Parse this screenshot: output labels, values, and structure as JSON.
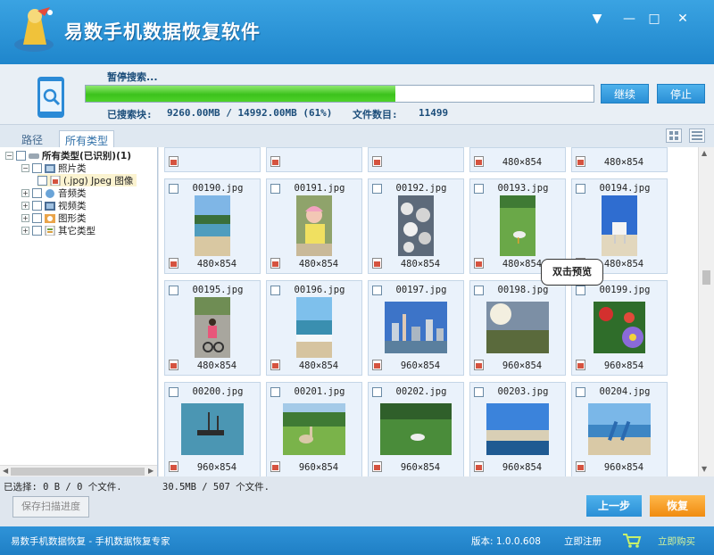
{
  "app": {
    "title": "易数手机数据恢复软件",
    "window_controls": {
      "menu": "▼",
      "minimize": "—",
      "maximize": "□",
      "close": "✕"
    }
  },
  "scan": {
    "status": "暂停搜索...",
    "progress_fraction": 0.61,
    "continue_label": "继续",
    "stop_label": "停止",
    "searched_label": "已搜索块:",
    "searched_value": "9260.00MB / 14992.00MB (61%)",
    "file_count_label": "文件数目:",
    "file_count_value": "11499"
  },
  "tabs": [
    {
      "label": "路径",
      "active": false
    },
    {
      "label": "所有类型",
      "active": true
    }
  ],
  "tree": {
    "root": "所有类型(已识别)(1)",
    "photos": "照片类",
    "jpeg": "(.jpg) Jpeg 图像",
    "audio": "音频类",
    "video": "视频类",
    "graphics": "图形类",
    "other": "其它类型"
  },
  "grid": {
    "partial_row": [
      {
        "dims": ""
      },
      {
        "dims": ""
      },
      {
        "dims": ""
      },
      {
        "dims": "480×854"
      },
      {
        "dims": "480×854"
      }
    ],
    "tiles": [
      {
        "name": "00190.jpg",
        "dims": "480×854",
        "thumb": "beach"
      },
      {
        "name": "00191.jpg",
        "dims": "480×854",
        "thumb": "child-pink"
      },
      {
        "name": "00192.jpg",
        "dims": "480×854",
        "thumb": "rocks"
      },
      {
        "name": "00193.jpg",
        "dims": "480×854",
        "thumb": "bird-grass"
      },
      {
        "name": "00194.jpg",
        "dims": "480×854",
        "thumb": "lifeguard-hut"
      },
      {
        "name": "00195.jpg",
        "dims": "480×854",
        "thumb": "child-bike"
      },
      {
        "name": "00196.jpg",
        "dims": "480×854",
        "thumb": "surf"
      },
      {
        "name": "00197.jpg",
        "dims": "960×854",
        "thumb": "city"
      },
      {
        "name": "00198.jpg",
        "dims": "960×854",
        "thumb": "sunset"
      },
      {
        "name": "00199.jpg",
        "dims": "960×854",
        "thumb": "flowers"
      },
      {
        "name": "00200.jpg",
        "dims": "960×854",
        "thumb": "boat"
      },
      {
        "name": "00201.jpg",
        "dims": "960×854",
        "thumb": "alpaca"
      },
      {
        "name": "00202.jpg",
        "dims": "960×854",
        "thumb": "bird-field"
      },
      {
        "name": "00203.jpg",
        "dims": "960×854",
        "thumb": "sea"
      },
      {
        "name": "00204.jpg",
        "dims": "960×854",
        "thumb": "surfers"
      }
    ]
  },
  "tooltip": "双击预览",
  "status": {
    "selected": "已选择: 0 B / 0 个文件.",
    "total": "30.5MB / 507 个文件."
  },
  "buttons": {
    "save_progress": "保存扫描进度",
    "prev": "上一步",
    "recover": "恢复"
  },
  "footer": {
    "slogan": "易数手机数据恢复 - 手机数据恢复专家",
    "version": "版本: 1.0.0.608",
    "register": "立即注册",
    "buy": "立即购买"
  }
}
